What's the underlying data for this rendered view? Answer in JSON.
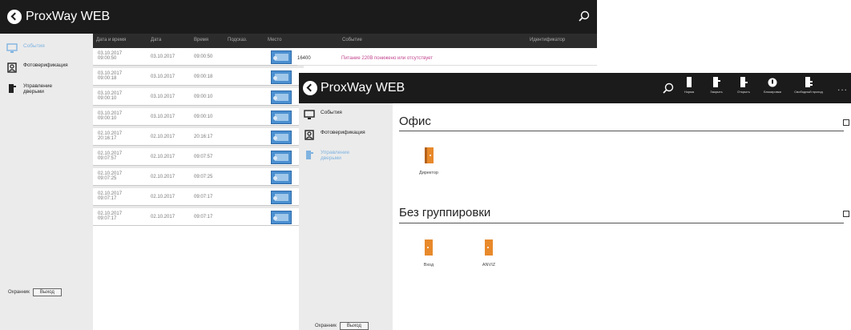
{
  "brand": {
    "name": "ProxWay WEB"
  },
  "colors": {
    "topbar": "#1b1b1b",
    "sidebar": "#ebebeb",
    "accent": "#7fb3e0",
    "door": "#e8892b",
    "event_text": "#c2458f"
  },
  "windowA": {
    "sidebar": {
      "items": [
        {
          "label": "События",
          "icon": "monitor-icon",
          "active": true
        },
        {
          "label": "Фотоверификация",
          "icon": "photo-id-icon",
          "active": false
        },
        {
          "label": "Управление дверьми",
          "icon": "door-control-icon",
          "active": false
        }
      ],
      "footer": {
        "status": "Охранник",
        "exit_button": "Выход"
      }
    },
    "table": {
      "columns": [
        "Дата и время",
        "Дата",
        "Время",
        "Подсказ.",
        "Место"
      ],
      "rows": [
        {
          "datetime": "03.10.2017 09:00:50",
          "date": "03.10.2017",
          "time": "09:00:50"
        },
        {
          "datetime": "03.10.2017 09:00:18",
          "date": "03.10.2017",
          "time": "09:00:18"
        },
        {
          "datetime": "03.10.2017 09:00:10",
          "date": "03.10.2017",
          "time": "09:00:10"
        },
        {
          "datetime": "03.10.2017 09:00:10",
          "date": "03.10.2017",
          "time": "09:00:10"
        },
        {
          "datetime": "02.10.2017 20:16:17",
          "date": "02.10.2017",
          "time": "20:16:17"
        },
        {
          "datetime": "02.10.2017 09:07:57",
          "date": "02.10.2017",
          "time": "09:07:57"
        },
        {
          "datetime": "02.10.2017 09:07:25",
          "date": "02.10.2017",
          "time": "09:07:25"
        },
        {
          "datetime": "02.10.2017 09:07:17",
          "date": "02.10.2017",
          "time": "09:07:17"
        },
        {
          "datetime": "02.10.2017 09:07:17",
          "date": "02.10.2017",
          "time": "09:07:17"
        }
      ]
    },
    "events_panel": {
      "columns": [
        "Событие",
        "Идентификатор"
      ],
      "rows": [
        {
          "id": "16400",
          "text": "Питание 220В понижено или отсутствует"
        }
      ]
    }
  },
  "windowB": {
    "toolbar": [
      {
        "label": "Норма",
        "icon": "door-normal-icon"
      },
      {
        "label": "Закрыть",
        "icon": "door-close-icon"
      },
      {
        "label": "Открыть",
        "icon": "door-open-icon"
      },
      {
        "label": "Блокировка",
        "icon": "lock-icon"
      },
      {
        "label": "Свободный проход",
        "icon": "free-pass-icon"
      }
    ],
    "more": "...",
    "sidebar": {
      "items": [
        {
          "label": "События",
          "icon": "monitor-icon",
          "active": false
        },
        {
          "label": "Фотоверификация",
          "icon": "photo-id-icon",
          "active": false
        },
        {
          "label": "Управление дверьми",
          "icon": "door-control-icon",
          "active": true
        }
      ],
      "footer": {
        "status": "Охранник",
        "exit_button": "Выход"
      }
    },
    "groups": [
      {
        "title": "Офис",
        "doors": [
          {
            "label": "Директор",
            "state": "open"
          }
        ]
      },
      {
        "title": "Без группировки",
        "doors": [
          {
            "label": "Вход",
            "state": "closed"
          },
          {
            "label": "ANVIZ",
            "state": "closed"
          }
        ]
      }
    ]
  }
}
